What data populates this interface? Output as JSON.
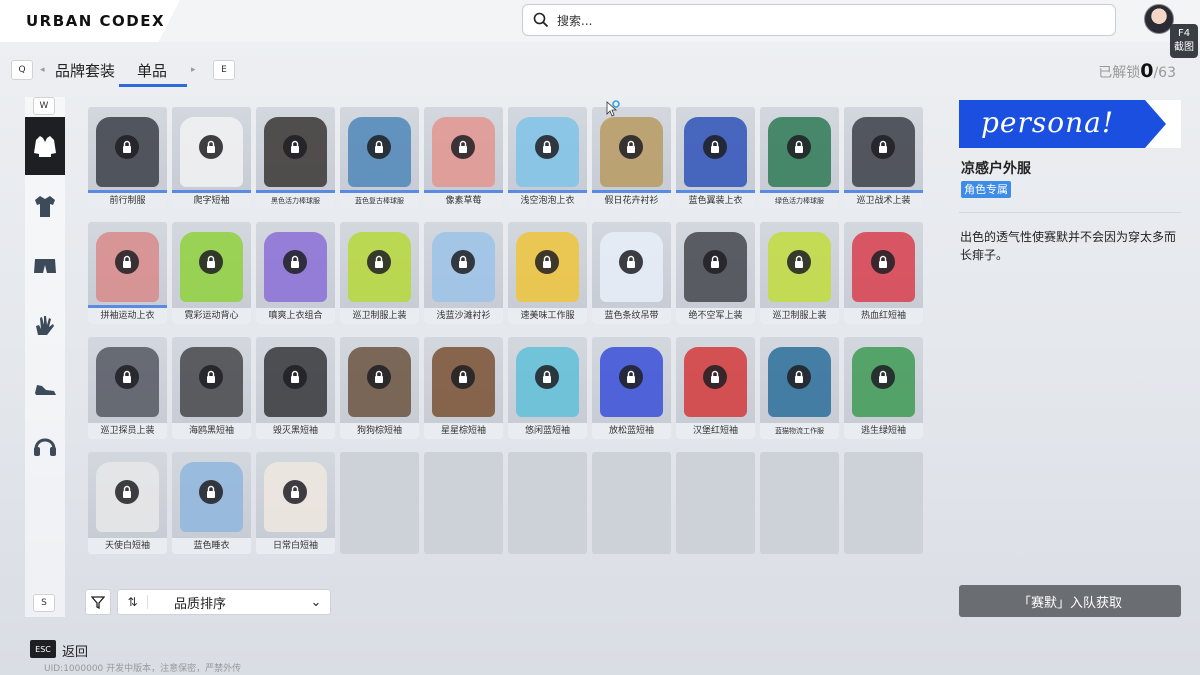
{
  "app": {
    "logo": "URBAN CODEX"
  },
  "search": {
    "placeholder": "搜索..."
  },
  "hotkey": {
    "key": "F4",
    "label": "截图"
  },
  "tabs": {
    "prev_key": "Q",
    "next_key": "E",
    "items": [
      "品牌套装",
      "单品"
    ],
    "active": "单品"
  },
  "unlock": {
    "label": "已解锁",
    "current": "0",
    "total": "/63"
  },
  "sidebar": {
    "top_key": "W",
    "bottom_key": "S",
    "items": [
      "jacket-icon",
      "shirt-icon",
      "shorts-icon",
      "gloves-icon",
      "shoes-icon",
      "headphones-icon"
    ]
  },
  "items": [
    {
      "label": "前行制服",
      "color": "#3b3e46"
    },
    {
      "label": "爬字短袖",
      "color": "#f2f2f2"
    },
    {
      "label": "黑色活力棒球服",
      "color": "#3a3633"
    },
    {
      "label": "蓝色复古棒球服",
      "color": "#4f86b8"
    },
    {
      "label": "像素草莓",
      "color": "#e3958f"
    },
    {
      "label": "浅空泡泡上衣",
      "color": "#7fc3e8"
    },
    {
      "label": "假日花卉衬衫",
      "color": "#b99a62"
    },
    {
      "label": "蓝色翼装上衣",
      "color": "#2f52b8"
    },
    {
      "label": "绿色活力棒球服",
      "color": "#2e7a55"
    },
    {
      "label": "巡卫战术上装",
      "color": "#3c3f48"
    },
    {
      "label": "拼袖运动上衣",
      "color": "#d98a8a"
    },
    {
      "label": "霓彩运动背心",
      "color": "#8fd13c"
    },
    {
      "label": "嗔爽上衣组合",
      "color": "#8a6fd6"
    },
    {
      "label": "巡卫制服上装",
      "color": "#b7d83a"
    },
    {
      "label": "浅蓝沙滩衬衫",
      "color": "#9cc3e8"
    },
    {
      "label": "速美味工作服",
      "color": "#efc43a"
    },
    {
      "label": "蓝色条纹吊带",
      "color": "#e8eef8"
    },
    {
      "label": "绝不空军上装",
      "color": "#44464d"
    },
    {
      "label": "巡卫制服上装",
      "color": "#c2dc3e"
    },
    {
      "label": "热血红短袖",
      "color": "#d9404e"
    },
    {
      "label": "巡卫探员上装",
      "color": "#555862"
    },
    {
      "label": "海鸥黑短袖",
      "color": "#45464a"
    },
    {
      "label": "毁灭黑短袖",
      "color": "#35363a"
    },
    {
      "label": "狗狗棕短袖",
      "color": "#6b5440"
    },
    {
      "label": "星星棕短袖",
      "color": "#7a5134"
    },
    {
      "label": "悠闲蓝短袖",
      "color": "#5fc0d8"
    },
    {
      "label": "放松蓝短袖",
      "color": "#3a4fd8"
    },
    {
      "label": "汉堡红短袖",
      "color": "#d43a3a"
    },
    {
      "label": "蓝猫物流工作服",
      "color": "#2c6f9a"
    },
    {
      "label": "逃生绿短袖",
      "color": "#3e9a55"
    },
    {
      "label": "天使白短袖",
      "color": "#e7e7e7"
    },
    {
      "label": "蓝色睡衣",
      "color": "#8fb6dd"
    },
    {
      "label": "日常白短袖",
      "color": "#f0e8e0"
    }
  ],
  "empty_slots": 7,
  "sort": {
    "label": "品质排序"
  },
  "footer": {
    "esc_key": "ESC",
    "back": "返回",
    "uid": "UID:1000000  开发中版本，注意保密，严禁外传"
  },
  "detail": {
    "banner_text": "persona!",
    "title": "凉感户外服",
    "badge": "角色专属",
    "description": "出色的透气性使赛默并不会因为穿太多而长痱子。",
    "acquire_button": "「赛默」入队获取"
  }
}
